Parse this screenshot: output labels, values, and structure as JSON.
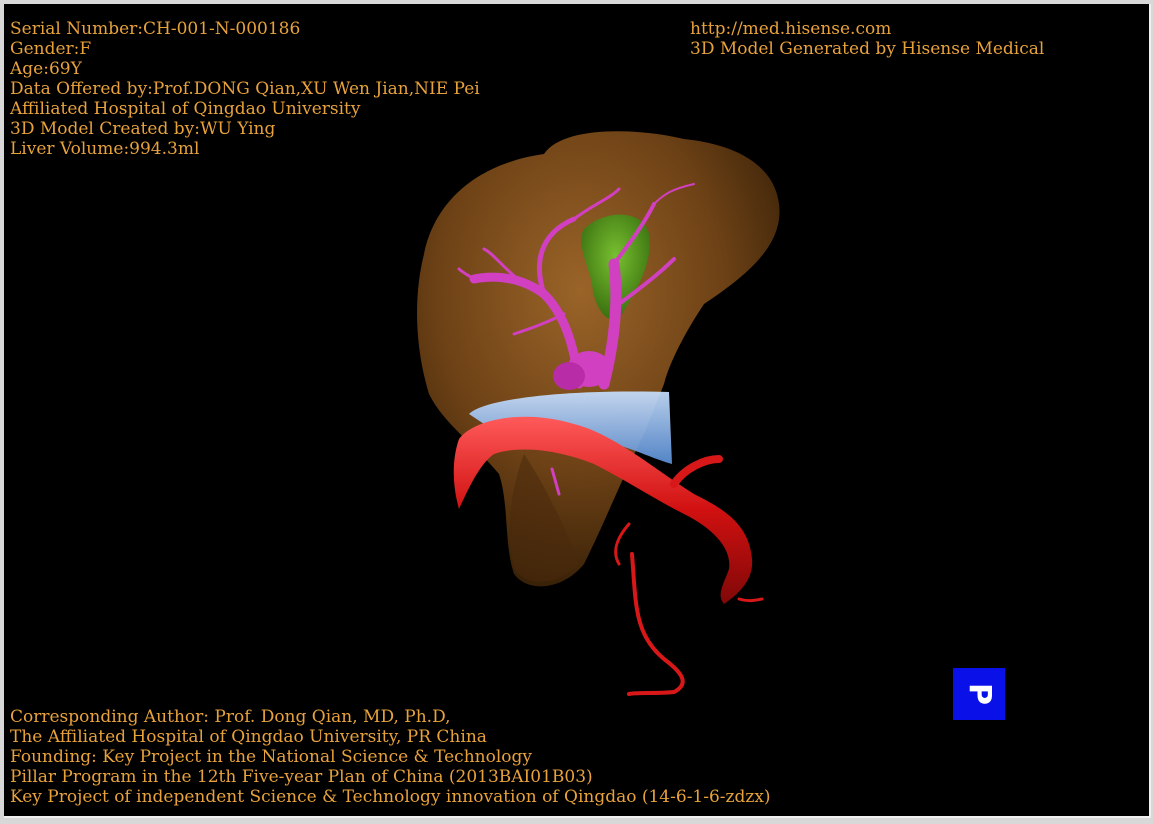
{
  "info_top_left": [
    "Serial Number:CH-001-N-000186",
    "Gender:F",
    "Age:69Y",
    "Data Offered by:Prof.DONG Qian,XU Wen Jian,NIE Pei",
    "Affiliated Hospital of Qingdao University",
    "3D Model Created by:WU Ying",
    "Liver Volume:994.3ml"
  ],
  "info_top_right": [
    "http://med.hisense.com",
    "3D Model Generated by Hisense Medical"
  ],
  "info_bottom_left": [
    "Corresponding Author: Prof. Dong Qian, MD, Ph.D,",
    "The Affiliated Hospital of Qingdao University, PR China",
    "Founding: Key Project in the National Science & Technology",
    "Pillar Program in the 12th Five-year Plan of China (2013BAI01B03)",
    "Key Project of independent Science & Technology innovation of Qingdao (14-6-1-6-zdzx)"
  ],
  "orientation_marker": {
    "label": "P",
    "color": "#0a10e8"
  },
  "colors": {
    "text": "#e8a23c",
    "background": "#000000",
    "liver": "#7a4a18",
    "gallbladder": "#5aa020",
    "portal_vein": "#d040c0",
    "vena_cava": "#8ab8f0",
    "artery": "#d81818"
  }
}
